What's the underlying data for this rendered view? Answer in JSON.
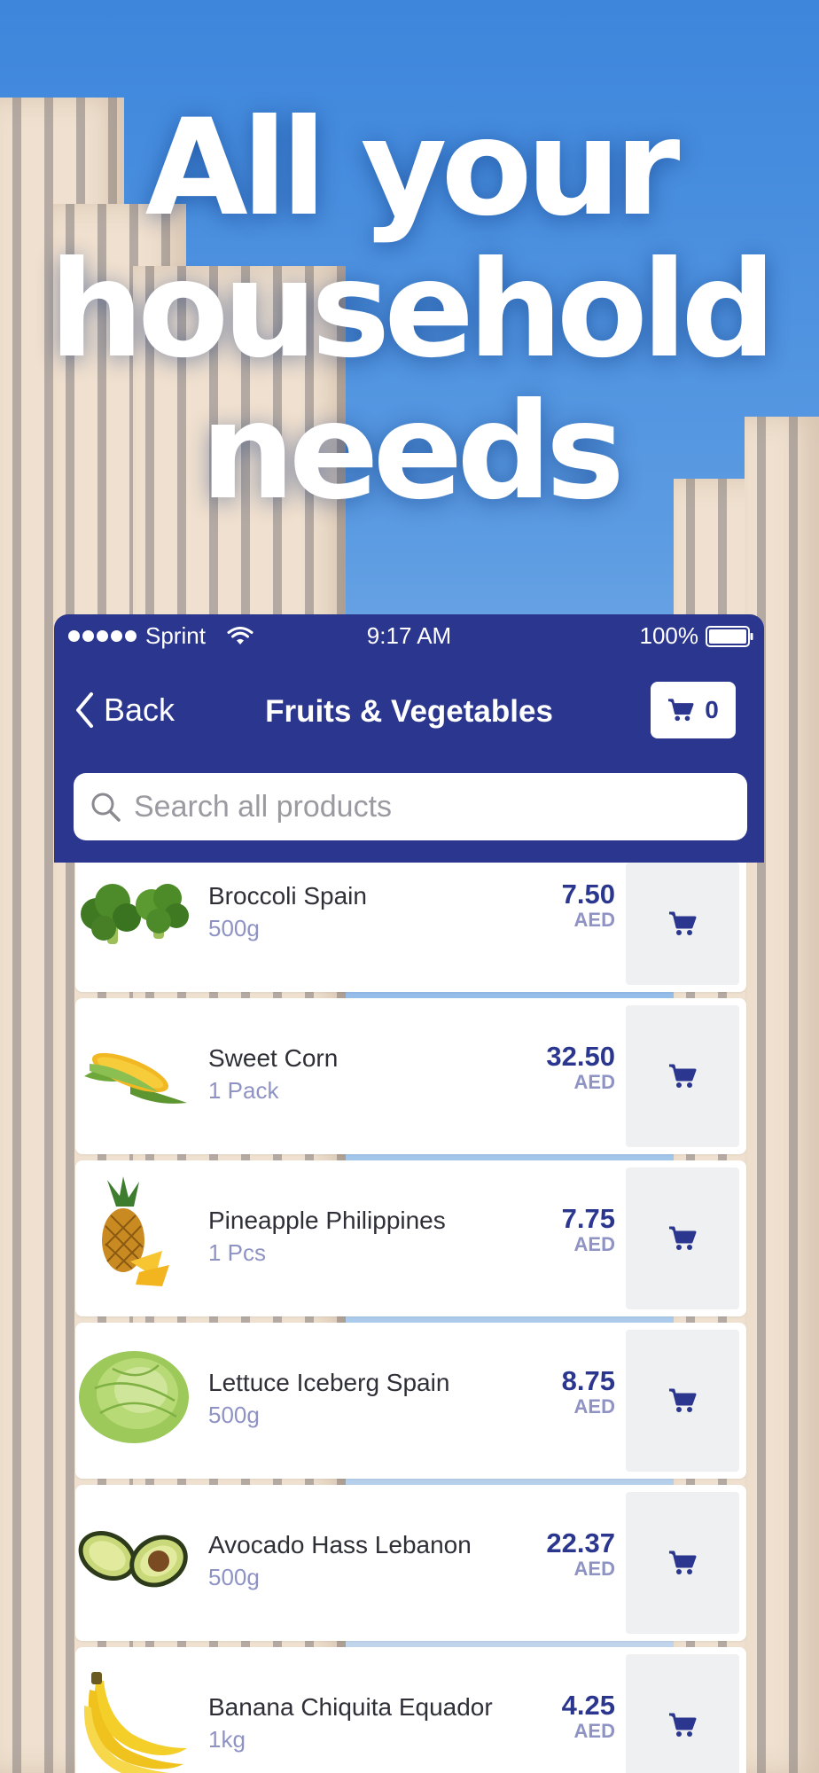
{
  "headline": {
    "line1": "All your",
    "line2": "household",
    "line3": "needs"
  },
  "status_bar": {
    "carrier": "Sprint",
    "time": "9:17 AM",
    "battery": "100%"
  },
  "nav": {
    "back_label": "Back",
    "title": "Fruits & Vegetables",
    "cart_count": "0",
    "color": "#2b368f"
  },
  "search": {
    "placeholder": "Search all products"
  },
  "products": [
    {
      "name": "Broccoli Spain",
      "qty": "500g",
      "price": "7.50",
      "currency": "AED",
      "icon": "broccoli"
    },
    {
      "name": "Sweet Corn",
      "qty": "1 Pack",
      "price": "32.50",
      "currency": "AED",
      "icon": "corn"
    },
    {
      "name": "Pineapple Philippines",
      "qty": "1 Pcs",
      "price": "7.75",
      "currency": "AED",
      "icon": "pineapple"
    },
    {
      "name": "Lettuce Iceberg Spain",
      "qty": "500g",
      "price": "8.75",
      "currency": "AED",
      "icon": "lettuce"
    },
    {
      "name": "Avocado Hass Lebanon",
      "qty": "500g",
      "price": "22.37",
      "currency": "AED",
      "icon": "avocado"
    },
    {
      "name": "Banana Chiquita Equador",
      "qty": "1kg",
      "price": "4.25",
      "currency": "AED",
      "icon": "banana"
    }
  ]
}
